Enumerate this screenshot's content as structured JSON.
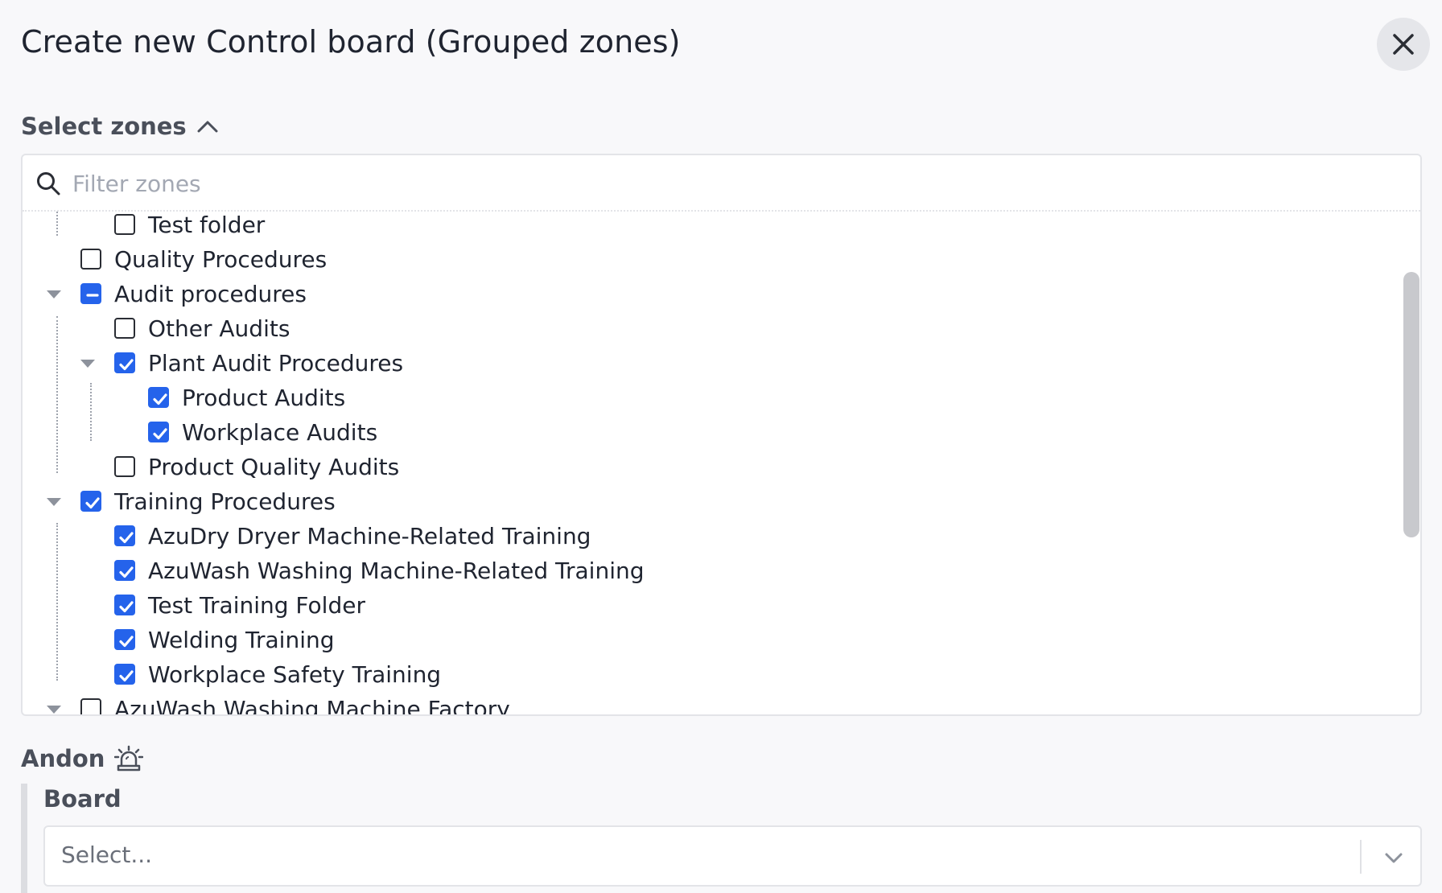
{
  "dialog": {
    "title": "Create new Control board (Grouped zones)",
    "close_icon": "close-icon"
  },
  "zones": {
    "label": "Select zones",
    "toggle_icon": "chevron-up-icon",
    "filter_placeholder": "Filter zones",
    "search_icon": "search-icon",
    "tree": [
      {
        "label": "Test folder",
        "level": 2,
        "state": "unchecked",
        "expandable": false
      },
      {
        "label": "Quality Procedures",
        "level": 1,
        "state": "unchecked",
        "expandable": false
      },
      {
        "label": "Audit procedures",
        "level": 1,
        "state": "partial",
        "expandable": true
      },
      {
        "label": "Other Audits",
        "level": 2,
        "state": "unchecked",
        "expandable": false
      },
      {
        "label": "Plant Audit Procedures",
        "level": 2,
        "state": "checked",
        "expandable": true
      },
      {
        "label": "Product Audits",
        "level": 3,
        "state": "checked",
        "expandable": false
      },
      {
        "label": "Workplace Audits",
        "level": 3,
        "state": "checked",
        "expandable": false
      },
      {
        "label": "Product Quality Audits",
        "level": 2,
        "state": "unchecked",
        "expandable": false
      },
      {
        "label": "Training Procedures",
        "level": 1,
        "state": "checked",
        "expandable": true
      },
      {
        "label": "AzuDry Dryer Machine-Related Training",
        "level": 2,
        "state": "checked",
        "expandable": false
      },
      {
        "label": "AzuWash Washing Machine-Related Training",
        "level": 2,
        "state": "checked",
        "expandable": false
      },
      {
        "label": "Test Training Folder",
        "level": 2,
        "state": "checked",
        "expandable": false
      },
      {
        "label": "Welding Training",
        "level": 2,
        "state": "checked",
        "expandable": false
      },
      {
        "label": "Workplace Safety Training",
        "level": 2,
        "state": "checked",
        "expandable": false
      },
      {
        "label": "AzuWash Washing Machine Factory",
        "level": 1,
        "state": "unchecked",
        "expandable": true
      }
    ]
  },
  "andon": {
    "label": "Andon",
    "icon": "siren-alarm-icon",
    "board": {
      "label": "Board",
      "placeholder": "Select...",
      "chevron_icon": "chevron-down-icon"
    }
  },
  "colors": {
    "accent": "#2563eb",
    "background": "#f8f8fa",
    "panel": "#ffffff",
    "border": "#e3e4e8",
    "muted_text": "#4a4f5a",
    "placeholder": "#a3a8b3"
  }
}
